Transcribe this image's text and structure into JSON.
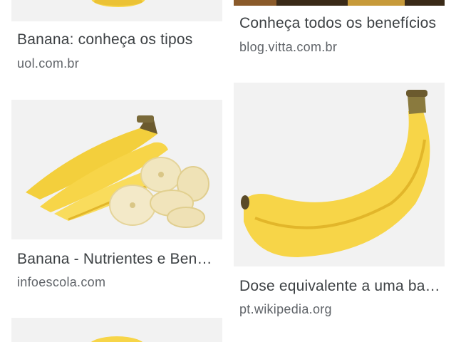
{
  "results": [
    {
      "title": "Banana: conheça os tipos",
      "source": "uol.com.br"
    },
    {
      "title": "Conheça todos os benefícios",
      "source": "blog.vitta.com.br"
    },
    {
      "title": "Banana - Nutrientes e Benefícios",
      "source": "infoescola.com"
    },
    {
      "title": "Dose equivalente a uma banana",
      "source": "pt.wikipedia.org"
    }
  ],
  "colors": {
    "banana_yellow": "#f7d548",
    "banana_shadow": "#e2b62a",
    "banana_stem": "#6b5a2e",
    "thumb_bg": "#f2f2f2",
    "title_text": "#3c4043",
    "source_text": "#5f6368"
  }
}
